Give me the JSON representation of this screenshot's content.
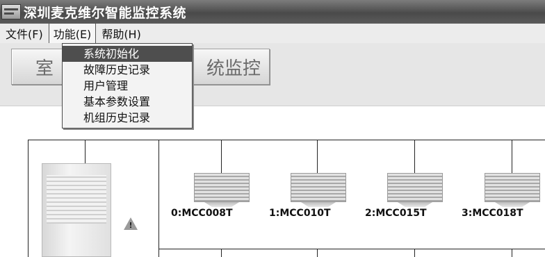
{
  "window": {
    "title": "深圳麦克维尔智能监控系统",
    "icon": "app-icon"
  },
  "menubar": {
    "items": [
      {
        "label": "文件(F)"
      },
      {
        "label": "功能(E)"
      },
      {
        "label": "帮助(H)"
      }
    ]
  },
  "toolbar": {
    "btn1_label": "室",
    "btn2_label": "统监控"
  },
  "dropdown": {
    "items": [
      {
        "label": "系统初始化",
        "highlighted": true
      },
      {
        "label": "故障历史记录"
      },
      {
        "label": "用户管理"
      },
      {
        "label": "基本参数设置"
      },
      {
        "label": "机组历史记录"
      }
    ]
  },
  "diagram": {
    "units": [
      {
        "label": "0:MCC008T"
      },
      {
        "label": "1:MCC010T"
      },
      {
        "label": "2:MCC015T"
      },
      {
        "label": "3:MCC018T"
      }
    ],
    "warning_icon": "warning-icon",
    "warning_mark": "!"
  },
  "colors": {
    "title_bar": "#5a5a5a",
    "menu_highlight": "#4e4e4e"
  }
}
